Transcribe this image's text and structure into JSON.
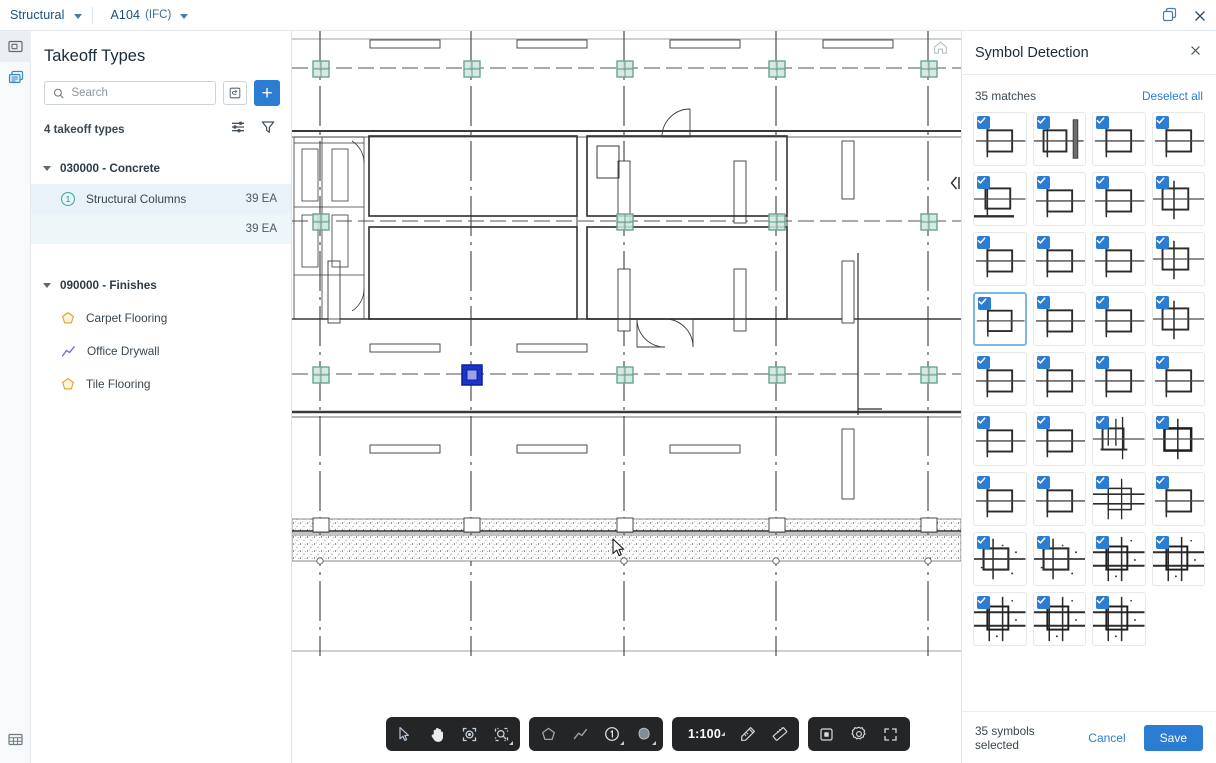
{
  "topbar": {
    "discipline": "Structural",
    "sheet": "A104",
    "sheet_suffix": "(IFC)",
    "copy_icon": "duplicate-icon",
    "close_icon": "close-icon"
  },
  "rail": {
    "items": [
      {
        "icon": "sheet-thumbnail-icon",
        "name": "sheets"
      },
      {
        "icon": "layers-stack-icon",
        "name": "takeoff"
      }
    ],
    "bottom": {
      "icon": "table-grid-icon",
      "name": "table"
    }
  },
  "panel": {
    "title": "Takeoff Types",
    "search": {
      "placeholder": "Search",
      "value": ""
    },
    "import_icon": "import-takeoff-icon",
    "add_label": "+",
    "count_label": "4 takeoff types",
    "settings_icon": "sliders-icon",
    "filter_icon": "filter-funnel-icon",
    "groups": [
      {
        "name": "030000 - Concrete",
        "rows": [
          {
            "label": "Structural Columns",
            "qty": "39 EA",
            "symbol": "circle-1",
            "selected": true
          }
        ],
        "subtotal": "39 EA"
      },
      {
        "name": "090000 - Finishes",
        "rows": [
          {
            "label": "Carpet Flooring",
            "qty": "",
            "symbol": "pentagon-amber",
            "selected": false
          },
          {
            "label": "Office Drywall",
            "qty": "",
            "symbol": "polyline-purple",
            "selected": false
          },
          {
            "label": "Tile Flooring",
            "qty": "",
            "symbol": "pentagon-amber",
            "selected": false
          }
        ],
        "subtotal": ""
      }
    ]
  },
  "canvas": {
    "home_icon": "home-icon",
    "cursor_icon": "mouse-pointer-icon",
    "slider_icon": "horizontal-resize-handle"
  },
  "toolbar": {
    "groups": [
      {
        "name": "selection-tools",
        "buttons": [
          {
            "name": "select-tool",
            "icon": "cursor-arrow-icon",
            "active": true,
            "corner": false
          },
          {
            "name": "pan-tool",
            "icon": "hand-icon",
            "active": false,
            "corner": false
          },
          {
            "name": "measure-region-tool",
            "icon": "focus-dot-icon",
            "active": false,
            "corner": false
          },
          {
            "name": "symbol-detect-tool",
            "icon": "search-region-icon",
            "active": false,
            "corner": true
          }
        ]
      },
      {
        "name": "markup-tools",
        "buttons": [
          {
            "name": "area-tool",
            "icon": "pentagon-icon",
            "active": false,
            "corner": false
          },
          {
            "name": "linear-tool",
            "icon": "polyline-icon",
            "active": false,
            "corner": false
          },
          {
            "name": "count-tool",
            "icon": "circle-1-icon",
            "active": false,
            "corner": true
          },
          {
            "name": "blob-tool",
            "icon": "blob-icon",
            "active": false,
            "corner": true
          }
        ]
      },
      {
        "name": "scale-tools",
        "scale_label": "1:100",
        "buttons": [
          {
            "name": "calibrate-tool",
            "icon": "ruler-pen-icon",
            "active": false,
            "corner": false
          },
          {
            "name": "measure-tool",
            "icon": "ruler-icon",
            "active": false,
            "corner": false
          }
        ]
      },
      {
        "name": "view-tools",
        "buttons": [
          {
            "name": "sheet-view-button",
            "icon": "sheet-square-icon",
            "active": false,
            "corner": false
          },
          {
            "name": "settings-button",
            "icon": "gear-icon",
            "active": false,
            "corner": false
          },
          {
            "name": "fullscreen-button",
            "icon": "expand-icon",
            "active": false,
            "corner": false
          }
        ]
      }
    ]
  },
  "symbol_detection": {
    "title": "Symbol Detection",
    "close_icon": "close-icon",
    "matches_label": "35 matches",
    "deselect_label": "Deselect all",
    "selected_label": "35 symbols selected",
    "cancel_label": "Cancel",
    "save_label": "Save",
    "active_index": 12,
    "thumbs": [
      {
        "variant": 0,
        "checked": true
      },
      {
        "variant": 1,
        "checked": true
      },
      {
        "variant": 0,
        "checked": true
      },
      {
        "variant": 0,
        "checked": true
      },
      {
        "variant": 2,
        "checked": true
      },
      {
        "variant": 0,
        "checked": true
      },
      {
        "variant": 0,
        "checked": true
      },
      {
        "variant": 3,
        "checked": true
      },
      {
        "variant": 0,
        "checked": true
      },
      {
        "variant": 0,
        "checked": true
      },
      {
        "variant": 0,
        "checked": true
      },
      {
        "variant": 3,
        "checked": true
      },
      {
        "variant": 0,
        "checked": true
      },
      {
        "variant": 0,
        "checked": true
      },
      {
        "variant": 0,
        "checked": true
      },
      {
        "variant": 3,
        "checked": true
      },
      {
        "variant": 0,
        "checked": true
      },
      {
        "variant": 0,
        "checked": true
      },
      {
        "variant": 0,
        "checked": true
      },
      {
        "variant": 0,
        "checked": true
      },
      {
        "variant": 0,
        "checked": true
      },
      {
        "variant": 0,
        "checked": true
      },
      {
        "variant": 4,
        "checked": true
      },
      {
        "variant": 5,
        "checked": true
      },
      {
        "variant": 0,
        "checked": true
      },
      {
        "variant": 0,
        "checked": true
      },
      {
        "variant": 6,
        "checked": true
      },
      {
        "variant": 0,
        "checked": true
      },
      {
        "variant": 7,
        "checked": true
      },
      {
        "variant": 7,
        "checked": true
      },
      {
        "variant": 8,
        "checked": true
      },
      {
        "variant": 8,
        "checked": true
      },
      {
        "variant": 8,
        "checked": true
      },
      {
        "variant": 8,
        "checked": true
      },
      {
        "variant": 8,
        "checked": true
      }
    ]
  },
  "colors": {
    "accent": "#2b7cd3",
    "link": "#2b7cd3",
    "selected_row_bg": "#e8f2f8",
    "toolbar_bg": "#232527",
    "marker_green": "#7fb8a8",
    "marker_selected": "#1c35c8"
  }
}
